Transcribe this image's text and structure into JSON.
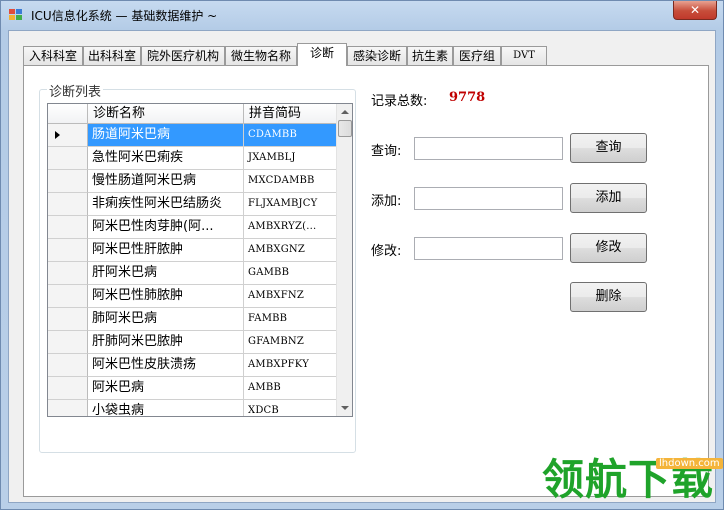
{
  "window": {
    "title": "ICU信息化系统 — 基础数据维护 ~",
    "close_label": "✕"
  },
  "tabs": [
    {
      "label": "入科科室",
      "active": false
    },
    {
      "label": "出科科室",
      "active": false
    },
    {
      "label": "院外医疗机构",
      "active": false
    },
    {
      "label": "微生物名称",
      "active": false
    },
    {
      "label": "诊断",
      "active": true
    },
    {
      "label": "感染诊断",
      "active": false
    },
    {
      "label": "抗生素",
      "active": false
    },
    {
      "label": "医疗组",
      "active": false
    },
    {
      "label": "DVT",
      "active": false
    }
  ],
  "diagnosis_list": {
    "group_title": "诊断列表",
    "columns": [
      "诊断名称",
      "拼音简码"
    ],
    "rows": [
      {
        "name": "肠道阿米巴病",
        "code": "CDAMBB",
        "selected": true
      },
      {
        "name": "急性阿米巴痢疾",
        "code": "JXAMBLJ",
        "selected": false
      },
      {
        "name": "慢性肠道阿米巴病",
        "code": "MXCDAMBB",
        "selected": false
      },
      {
        "name": "非痢疾性阿米巴结肠炎",
        "code": "FLJXAMBJCY",
        "selected": false
      },
      {
        "name": "阿米巴性肉芽肿(阿...",
        "code": "AMBXRYZ(...",
        "selected": false
      },
      {
        "name": "阿米巴性肝脓肿",
        "code": "AMBXGNZ",
        "selected": false
      },
      {
        "name": "肝阿米巴病",
        "code": "GAMBB",
        "selected": false
      },
      {
        "name": "阿米巴性肺脓肿",
        "code": "AMBXFNZ",
        "selected": false
      },
      {
        "name": "肺阿米巴病",
        "code": "FAMBB",
        "selected": false
      },
      {
        "name": "肝肺阿米巴脓肿",
        "code": "GFAMBNZ",
        "selected": false
      },
      {
        "name": "阿米巴性皮肤溃疡",
        "code": "AMBXPFKY",
        "selected": false
      },
      {
        "name": "阿米巴病",
        "code": "AMBB",
        "selected": false
      },
      {
        "name": "小袋虫病",
        "code": "XDCB",
        "selected": false
      }
    ]
  },
  "record_count": {
    "label": "记录总数:",
    "value": "9778",
    "color": "#c00000"
  },
  "query": {
    "label": "查询:",
    "value": "",
    "button": "查询"
  },
  "add": {
    "label": "添加:",
    "value": "",
    "button": "添加"
  },
  "modify": {
    "label": "修改:",
    "value": "",
    "button": "修改"
  },
  "delete_button": "删除",
  "watermark": {
    "text": "领航下载",
    "url": "lhdown.com",
    "color": "#1fa32a"
  }
}
